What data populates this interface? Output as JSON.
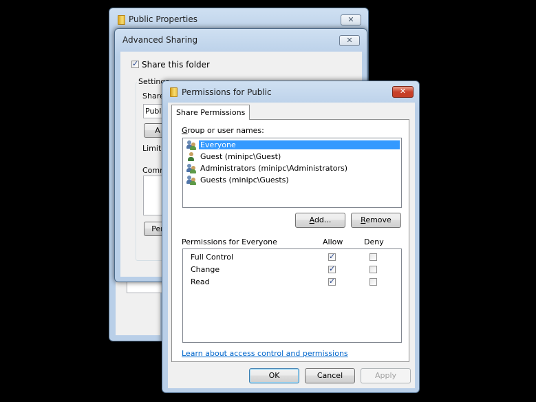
{
  "public_properties": {
    "title": "Public Properties",
    "close": "✕"
  },
  "advanced_sharing": {
    "title": "Advanced Sharing",
    "close": "✕",
    "share_checkbox_label": "Share this folder",
    "share_checked": true,
    "settings_group": "Settings",
    "share_name_label": "Share",
    "share_name_value": "Public",
    "add_button": "A",
    "limit_label": "Limit t",
    "comments_label": "Comm",
    "permissions_button": "Per"
  },
  "permissions": {
    "title": "Permissions for Public",
    "close": "✕",
    "tab": "Share Permissions",
    "group_label": "Group or user names:",
    "users": [
      {
        "name": "Everyone",
        "selected": true,
        "icon": "group-icon"
      },
      {
        "name": "Guest (minipc\\Guest)",
        "selected": false,
        "icon": "user-icon"
      },
      {
        "name": "Administrators (minipc\\Administrators)",
        "selected": false,
        "icon": "group-icon"
      },
      {
        "name": "Guests (minipc\\Guests)",
        "selected": false,
        "icon": "group-icon"
      }
    ],
    "add_button": "Add...",
    "remove_button": "Remove",
    "perm_header": "Permissions for Everyone",
    "allow_header": "Allow",
    "deny_header": "Deny",
    "rows": [
      {
        "name": "Full Control",
        "allow": true,
        "deny": false
      },
      {
        "name": "Change",
        "allow": true,
        "deny": false
      },
      {
        "name": "Read",
        "allow": true,
        "deny": false
      }
    ],
    "link": "Learn about access control and permissions",
    "ok_button": "OK",
    "cancel_button": "Cancel",
    "apply_button": "Apply"
  }
}
